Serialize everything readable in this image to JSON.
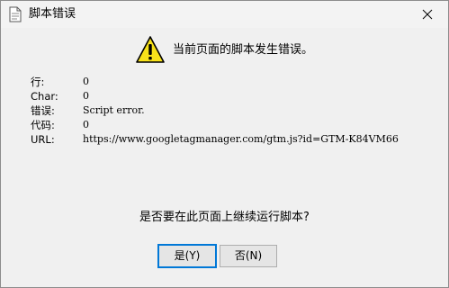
{
  "window": {
    "title": "脚本错误",
    "close_symbol": "✕"
  },
  "message": "当前页面的脚本发生错误。",
  "details": [
    {
      "label": "行:",
      "value": "0"
    },
    {
      "label": "Char:",
      "value": "0"
    },
    {
      "label": "错误:",
      "value": "Script error."
    },
    {
      "label": "代码:",
      "value": "0"
    },
    {
      "label": "URL:",
      "value": "https://www.googletagmanager.com/gtm.js?id=GTM-K84VM66"
    }
  ],
  "question": "是否要在此页面上继续运行脚本?",
  "buttons": {
    "yes_label": "是(Y)",
    "no_label": "否(N)"
  },
  "icons": {
    "title": "document-icon",
    "warning": "warning-icon",
    "close": "close-icon"
  },
  "colors": {
    "warning_fill": "#f8e21a",
    "default_button_border": "#0078d7"
  }
}
